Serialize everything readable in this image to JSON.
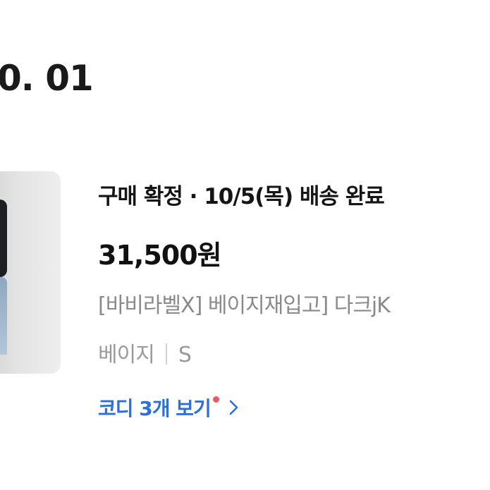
{
  "section": {
    "date": "0. 01"
  },
  "order": {
    "status": "구매 확정 · 10/5(목) 배송 완료",
    "price": "31,500원",
    "product_name": "[바비라벨X] 베이지재입고] 다크jK",
    "option_color": "베이지",
    "option_size": "S",
    "codi_link_label": "코디 3개 보기",
    "codi_has_new": true,
    "icons": {
      "new_dot": "notification-dot-icon",
      "chevron": "chevron-right-icon"
    }
  },
  "colors": {
    "accent": "#2f6fd9",
    "new_dot": "#ec5b62",
    "secondary_text": "#8a8a8a"
  }
}
